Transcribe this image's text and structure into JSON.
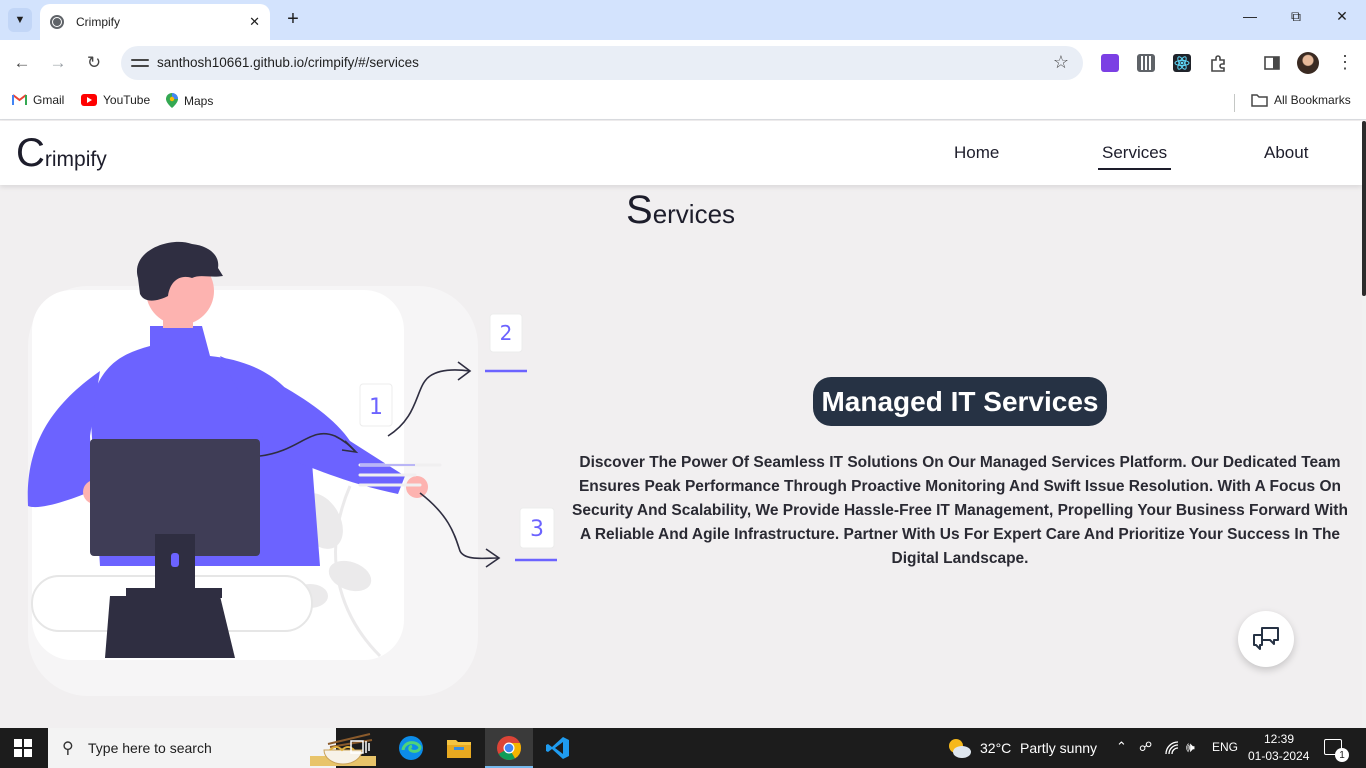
{
  "browser": {
    "tab_title": "Crimpify",
    "url": "santhosh10661.github.io/crimpify/#/services",
    "bookmarks": [
      {
        "label": "Gmail",
        "icon": "gmail-icon"
      },
      {
        "label": "YouTube",
        "icon": "youtube-icon"
      },
      {
        "label": "Maps",
        "icon": "maps-icon"
      }
    ],
    "all_bookmarks_label": "All Bookmarks"
  },
  "site": {
    "logo_initial": "C",
    "logo_rest": "rimpify",
    "nav": [
      {
        "label": "Home",
        "active": false
      },
      {
        "label": "Services",
        "active": true
      },
      {
        "label": "About",
        "active": false
      }
    ],
    "section_title_initial": "S",
    "section_title_rest": "ervices",
    "service_heading": "Managed IT Services",
    "service_description": "Discover The Power Of Seamless IT Solutions On Our Managed Services Platform. Our Dedicated Team Ensures Peak Performance Through Proactive Monitoring And Swift Issue Resolution. With A Focus On Security And Scalability, We Provide Hassle-Free IT Management, Propelling Your Business Forward With A Reliable And Agile Infrastructure. Partner With Us For Expert Care And Prioritize Your Success In The Digital Landscape.",
    "illustration_labels": [
      "1",
      "2",
      "3"
    ],
    "colors": {
      "accent_purple": "#6c63ff",
      "dark_navy": "#263244",
      "page_bg": "#f1eff0"
    }
  },
  "taskbar": {
    "search_placeholder": "Type here to search",
    "weather_temp": "32°C",
    "weather_desc": "Partly sunny",
    "language": "ENG",
    "time": "12:39",
    "date": "01-03-2024",
    "notification_count": "1"
  }
}
